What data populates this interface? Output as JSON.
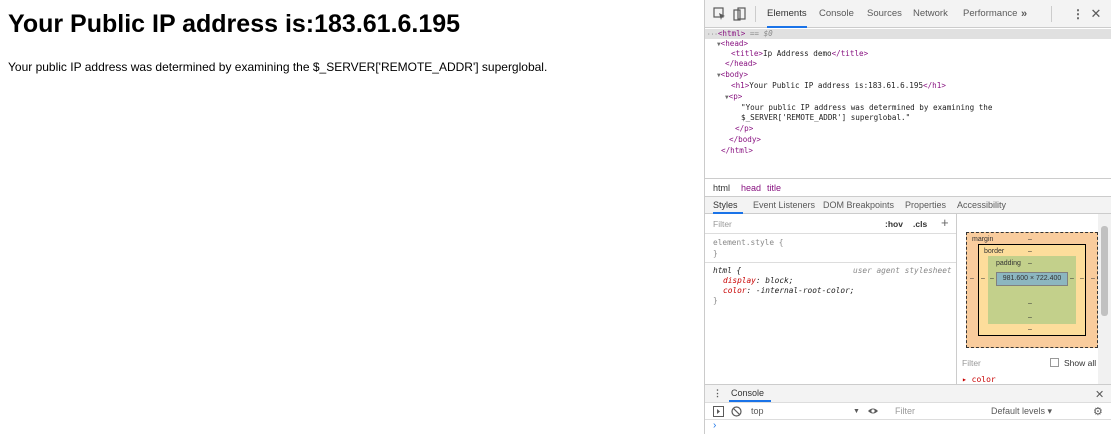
{
  "page": {
    "heading": "Your Public IP address is:183.61.6.195",
    "paragraph": "Your public IP address was determined by examining the $_SERVER['REMOTE_ADDR'] superglobal."
  },
  "devtools": {
    "tabs": [
      "Elements",
      "Console",
      "Sources",
      "Network",
      "Performance"
    ],
    "active_tab": "Elements",
    "more_tabs": "»",
    "dom": {
      "html_open": "<html>",
      "selected_marker": "== $0",
      "head_open": "<head>",
      "title_open": "<title>",
      "title_text": "Ip Address demo",
      "title_close": "</title>",
      "head_close": "</head>",
      "body_open": "<body>",
      "h1_open": "<h1>",
      "h1_text": "Your Public IP address is:183.61.6.195",
      "h1_close": "</h1>",
      "p_open": "<p>",
      "p_text_1": "\"Your public IP address was determined by examining the",
      "p_text_2": "$_SERVER['REMOTE_ADDR'] superglobal.\"",
      "p_close": "</p>",
      "body_close": "</body>",
      "html_close": "</html>"
    },
    "breadcrumbs": [
      "html",
      "head",
      "title"
    ],
    "subtabs": [
      "Styles",
      "Event Listeners",
      "DOM Breakpoints",
      "Properties",
      "Accessibility"
    ],
    "styles": {
      "filter_placeholder": "Filter",
      "hov": ":hov",
      "cls": ".cls",
      "plus": "+",
      "element_style": "element.style {",
      "element_close": "}",
      "html_selector": "html {",
      "ua_label": "user agent stylesheet",
      "decl1_prop": "display",
      "decl1_val": "block;",
      "decl2_prop": "color",
      "decl2_val": "-internal-root-color;",
      "html_close": "}"
    },
    "box_model": {
      "margin_label": "margin",
      "border_label": "border",
      "padding_label": "padding",
      "dash": "–",
      "content": "981.600 × 722.400",
      "filter_placeholder": "Filter",
      "show_all": "Show all",
      "next_prop": "▸ color"
    },
    "console": {
      "tab": "Console",
      "context": "top",
      "filter_placeholder": "Filter",
      "levels": "Default levels ▾",
      "prompt": "›"
    }
  }
}
